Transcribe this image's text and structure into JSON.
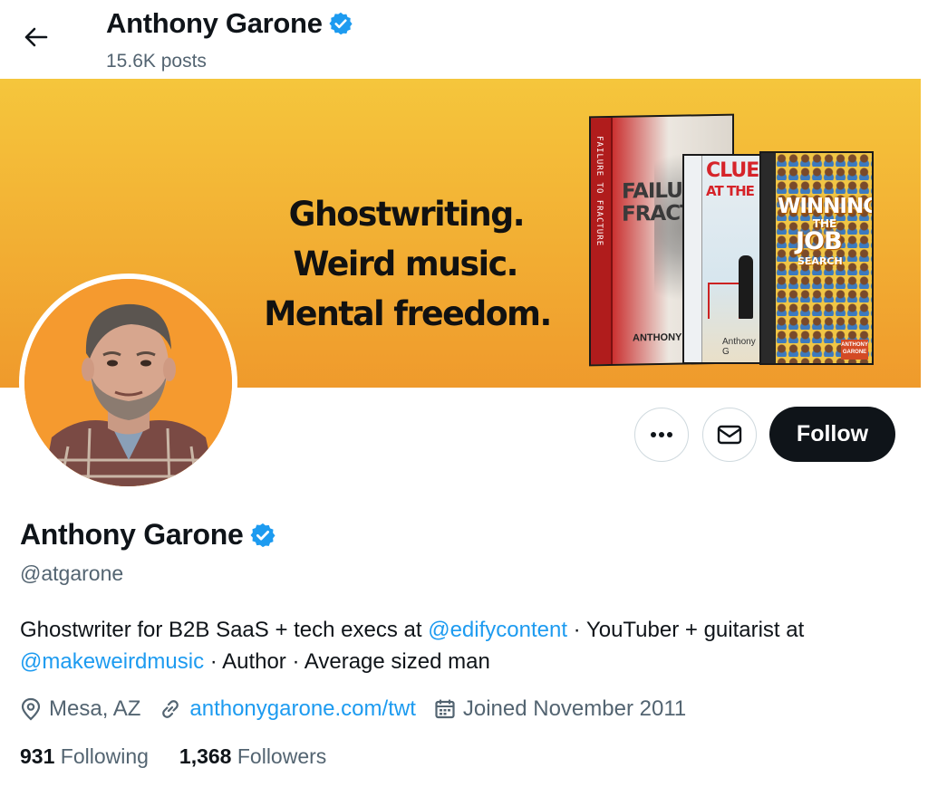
{
  "header": {
    "back_icon": "arrow-left-icon",
    "name": "Anthony Garone",
    "posts": "15.6K posts"
  },
  "banner": {
    "lines": [
      "Ghostwriting.",
      "Weird music.",
      "Mental freedom."
    ],
    "book1": {
      "spine": "FAILURE TO FRACTURE",
      "title_a": "FAILURE",
      "title_b": "FRACTU",
      "author": "ANTHONY GAR"
    },
    "book2": {
      "title_a": "CLUEL",
      "title_b": "AT THE",
      "author": "Anthony G"
    },
    "book3": {
      "t1": "WINNING",
      "t2": "THE",
      "t3": "JOB",
      "t4": "SEARCH",
      "label": "ANTHONY GARONE"
    }
  },
  "actions": {
    "more_icon": "ellipsis-icon",
    "message_icon": "envelope-icon",
    "follow_label": "Follow"
  },
  "profile": {
    "name": "Anthony Garone",
    "handle": "@atgarone",
    "bio": {
      "part1": "Ghostwriter for B2B SaaS + tech execs at ",
      "mention1": "@edifycontent",
      "part2": " · YouTuber + guitarist at ",
      "mention2": "@makeweirdmusic",
      "part3": " · Author · Average sized man"
    },
    "location": "Mesa, AZ",
    "website": "anthonygarone.com/twt",
    "joined": "Joined November 2011",
    "following_count": "931",
    "following_label": "Following",
    "followers_count": "1,368",
    "followers_label": "Followers"
  },
  "colors": {
    "accent": "#1d9bf0",
    "text": "#0f1419",
    "muted": "#536471",
    "verified": "#1d9bf0",
    "banner": "#f2ae33"
  }
}
